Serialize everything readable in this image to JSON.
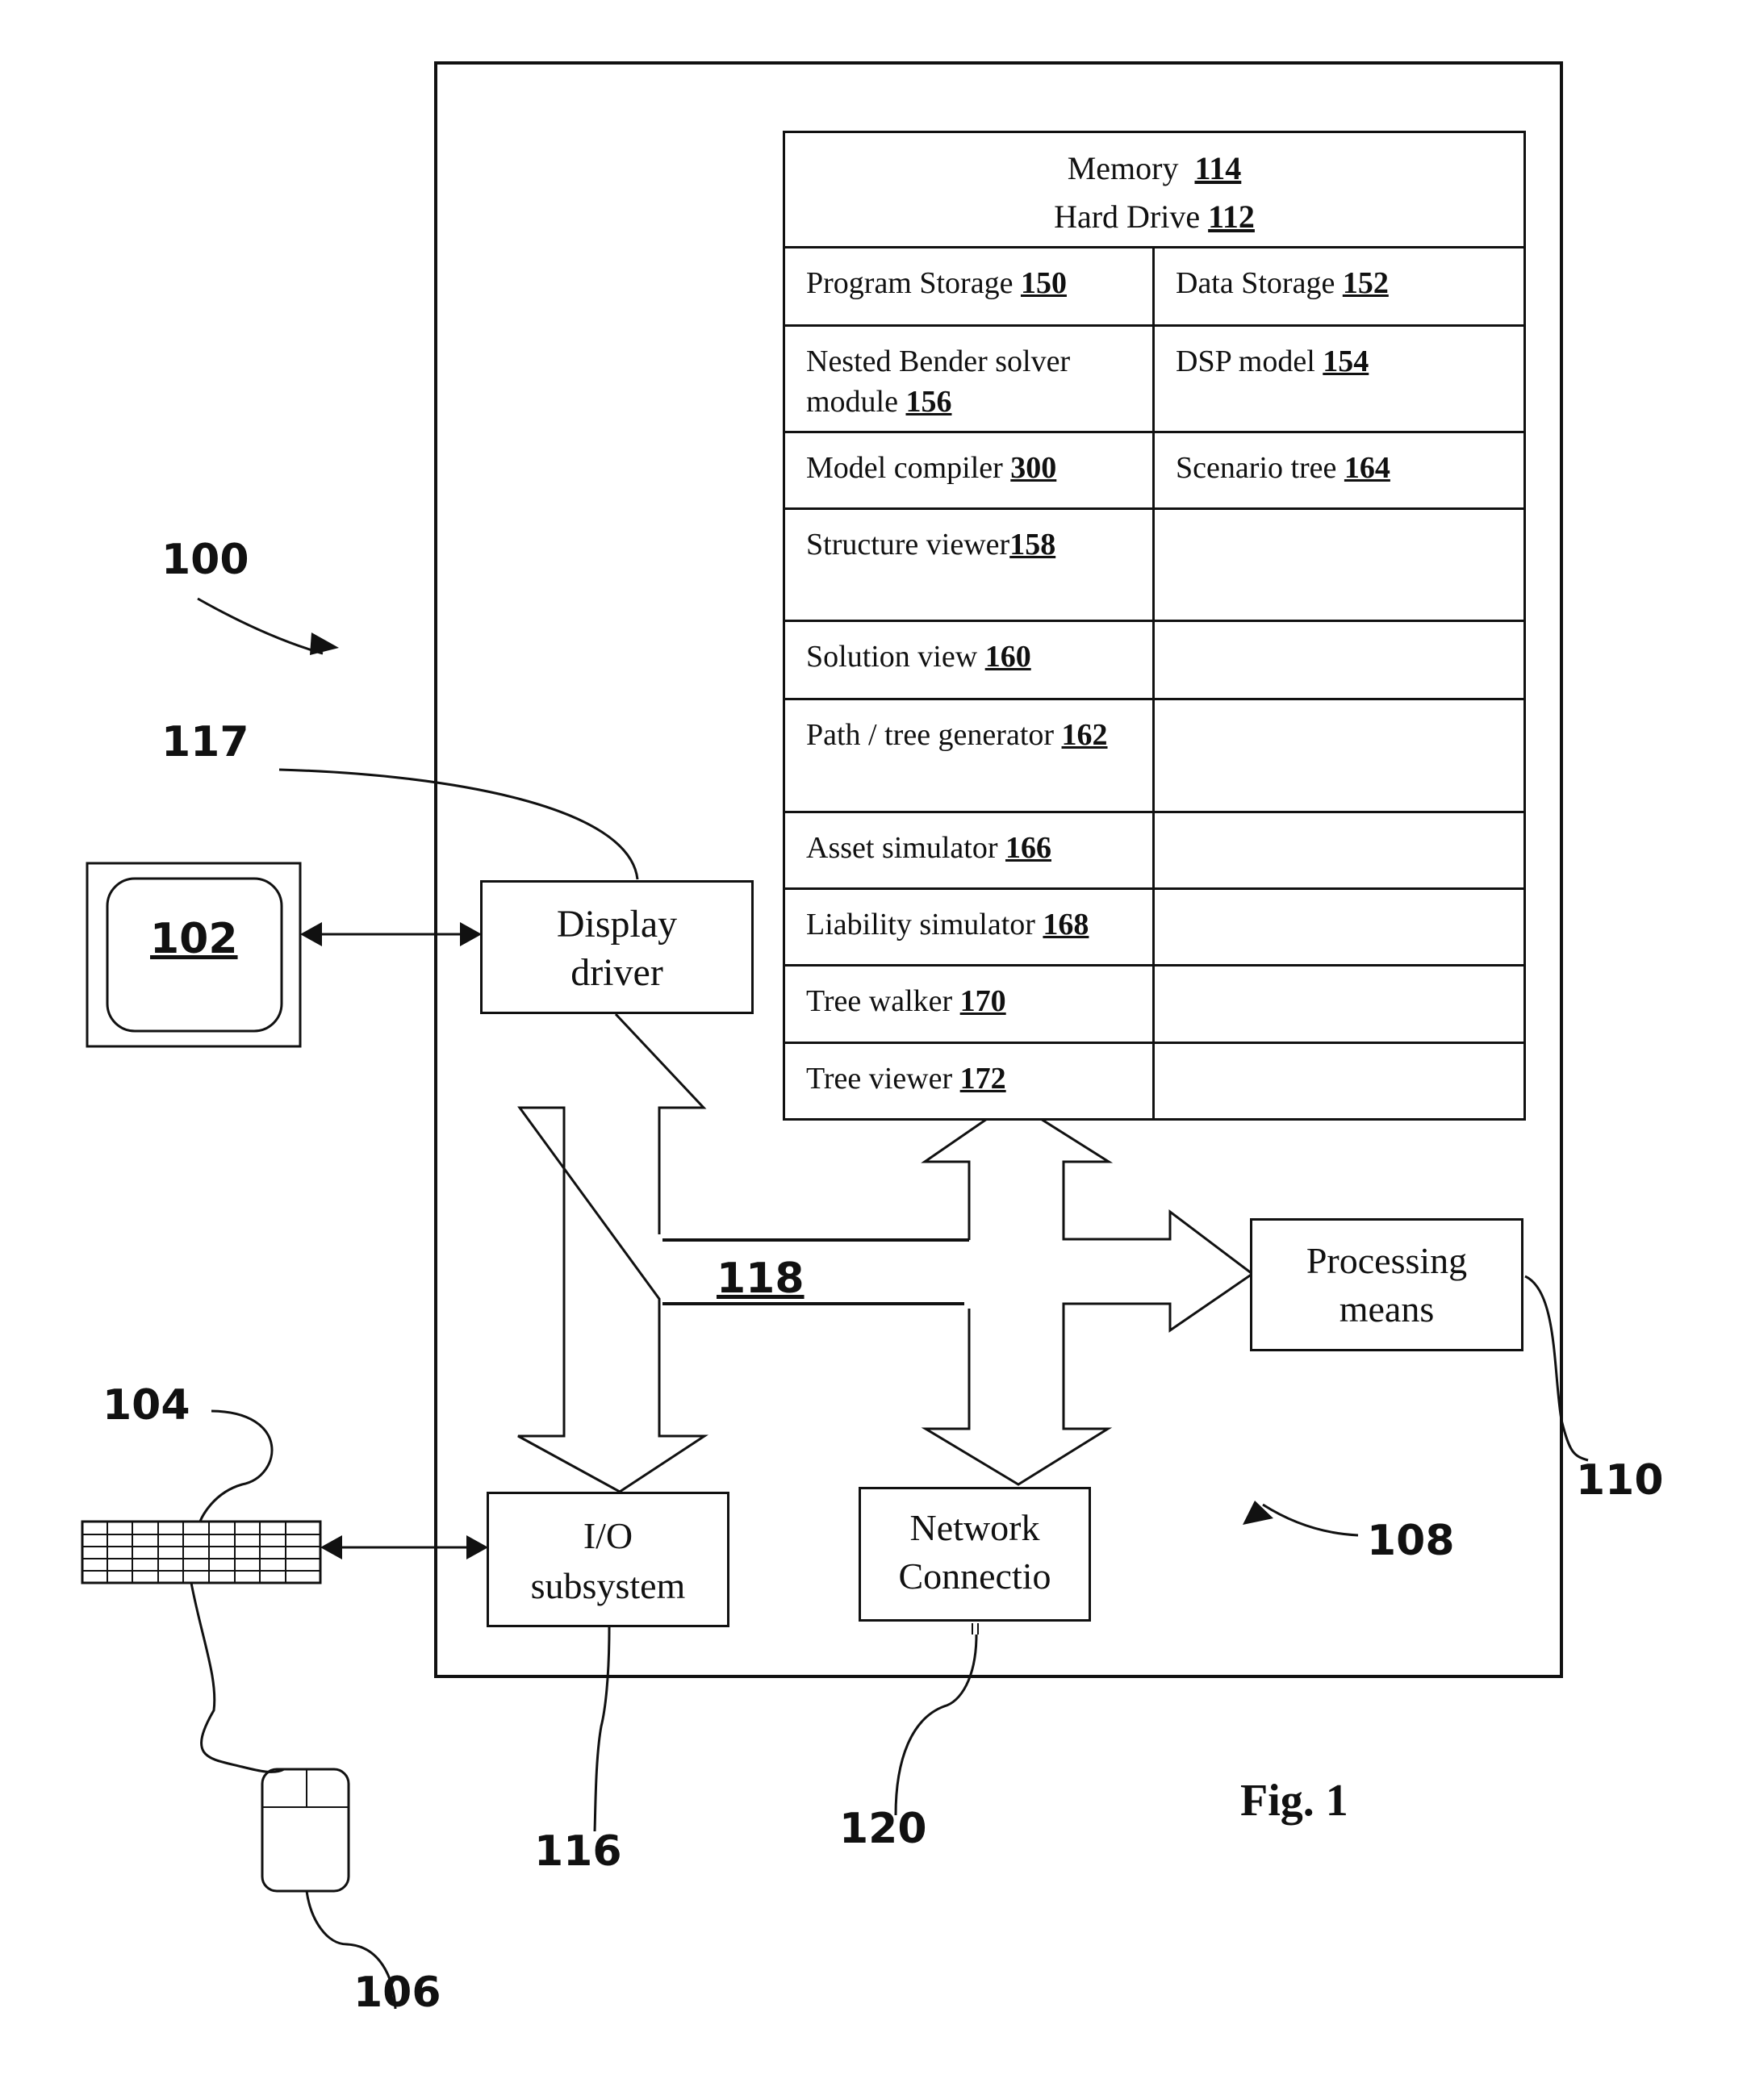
{
  "figure": {
    "caption": "Fig. 1",
    "system_ref": "100",
    "computer_ref": "108",
    "bus_ref": "118"
  },
  "memory_table": {
    "header_line1_label": "Memory",
    "header_line1_ref": "114",
    "header_line2_label": "Hard Drive",
    "header_line2_ref": "112",
    "rows": [
      {
        "left_label": "Program Storage ",
        "left_ref": "150",
        "right_label": "Data Storage ",
        "right_ref": "152"
      },
      {
        "left_label": "Nested Bender solver module ",
        "left_ref": "156",
        "right_label": "DSP model ",
        "right_ref": "154"
      },
      {
        "left_label": "Model compiler ",
        "left_ref": "300",
        "right_label": "Scenario tree ",
        "right_ref": "164"
      },
      {
        "left_label": "Structure viewer",
        "left_ref": "158",
        "right_label": "",
        "right_ref": ""
      },
      {
        "left_label": "Solution view ",
        "left_ref": "160",
        "right_label": "",
        "right_ref": ""
      },
      {
        "left_label": "Path / tree generator ",
        "left_ref": "162",
        "right_label": "",
        "right_ref": ""
      },
      {
        "left_label": "Asset simulator ",
        "left_ref": "166",
        "right_label": "",
        "right_ref": ""
      },
      {
        "left_label": "Liability simulator ",
        "left_ref": "168",
        "right_label": "",
        "right_ref": ""
      },
      {
        "left_label": "Tree walker ",
        "left_ref": "170",
        "right_label": "",
        "right_ref": ""
      },
      {
        "left_label": "Tree viewer ",
        "left_ref": "172",
        "right_label": "",
        "right_ref": ""
      }
    ]
  },
  "components": {
    "display_driver": {
      "line1": "Display",
      "line2": "driver",
      "ref": "117"
    },
    "processing_means": {
      "line1": "Processing",
      "line2": "means",
      "ref": "110"
    },
    "io_subsystem": {
      "line1": "I/O",
      "line2": "subsystem",
      "ref": "116"
    },
    "network_connection": {
      "line1": "Network",
      "line2": "Connectio",
      "ref": "120"
    },
    "monitor": {
      "ref": "102"
    },
    "keyboard": {
      "ref": "104"
    },
    "mouse": {
      "ref": "106"
    }
  }
}
